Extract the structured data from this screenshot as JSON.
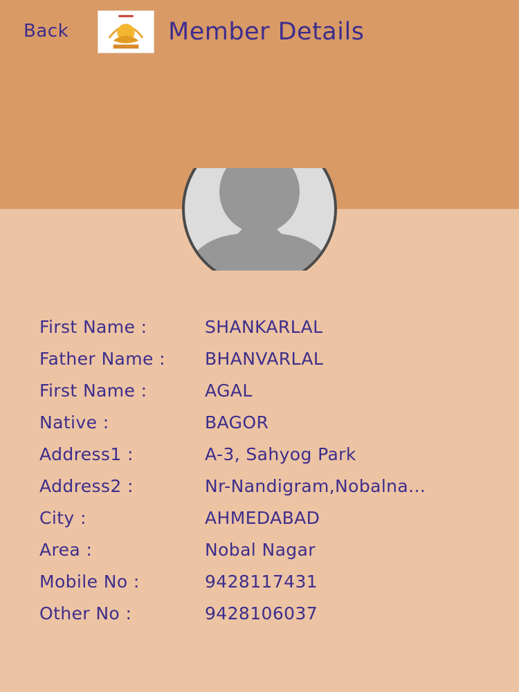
{
  "header": {
    "back_label": "Back",
    "title": "Member Details",
    "band_color": "#d99a66"
  },
  "icons": {
    "logo": "org-logo-icon",
    "avatar": "person-placeholder-icon"
  },
  "colors": {
    "text": "#3d2d8c",
    "background": "#edc4a3"
  },
  "details": [
    {
      "label": "First Name :",
      "value": "SHANKARLAL"
    },
    {
      "label": "Father Name :",
      "value": "BHANVARLAL"
    },
    {
      "label": "First Name :",
      "value": "AGAL"
    },
    {
      "label": "Native :",
      "value": "BAGOR"
    },
    {
      "label": "Address1 :",
      "value": "A-3, Sahyog Park"
    },
    {
      "label": "Address2 :",
      "value": "Nr-Nandigram,Nobalna..."
    },
    {
      "label": "City :",
      "value": "AHMEDABAD"
    },
    {
      "label": "Area :",
      "value": "Nobal Nagar"
    },
    {
      "label": "Mobile No :",
      "value": "9428117431"
    },
    {
      "label": "Other No :",
      "value": "9428106037"
    }
  ]
}
